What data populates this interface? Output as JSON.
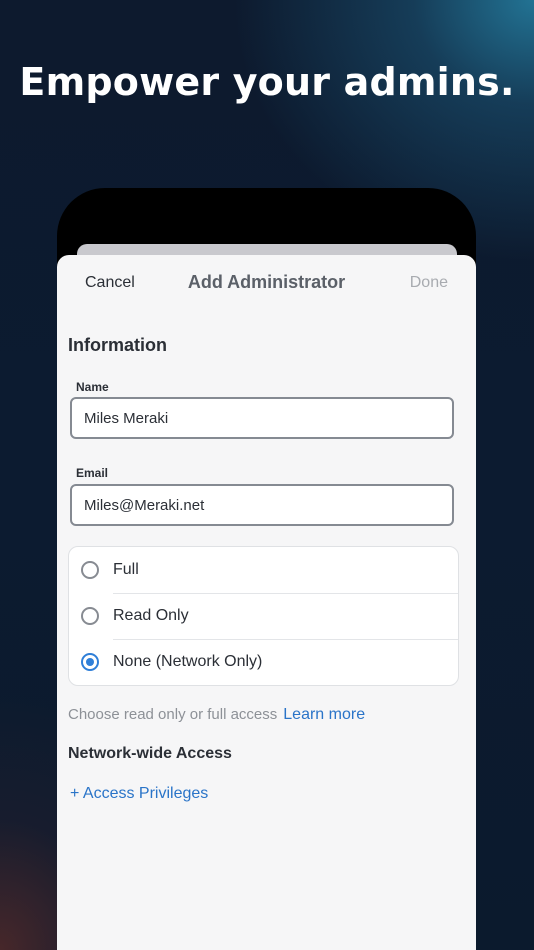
{
  "headline": "Empower your admins.",
  "nav": {
    "cancel": "Cancel",
    "title": "Add Administrator",
    "done": "Done"
  },
  "information": {
    "title": "Information",
    "name_label": "Name",
    "name_value": "Miles Meraki",
    "email_label": "Email",
    "email_value": "Miles@Meraki.net"
  },
  "access_options": [
    {
      "label": "Full",
      "selected": false
    },
    {
      "label": "Read Only",
      "selected": false
    },
    {
      "label": "None (Network Only)",
      "selected": true
    }
  ],
  "hint": {
    "text": "Choose read only or full access",
    "link": "Learn more"
  },
  "network": {
    "title": "Network-wide Access",
    "link": "+ Access Privileges"
  },
  "colors": {
    "accent": "#2f7fd8",
    "link": "#2a74c8",
    "background": "#0c1b30"
  }
}
